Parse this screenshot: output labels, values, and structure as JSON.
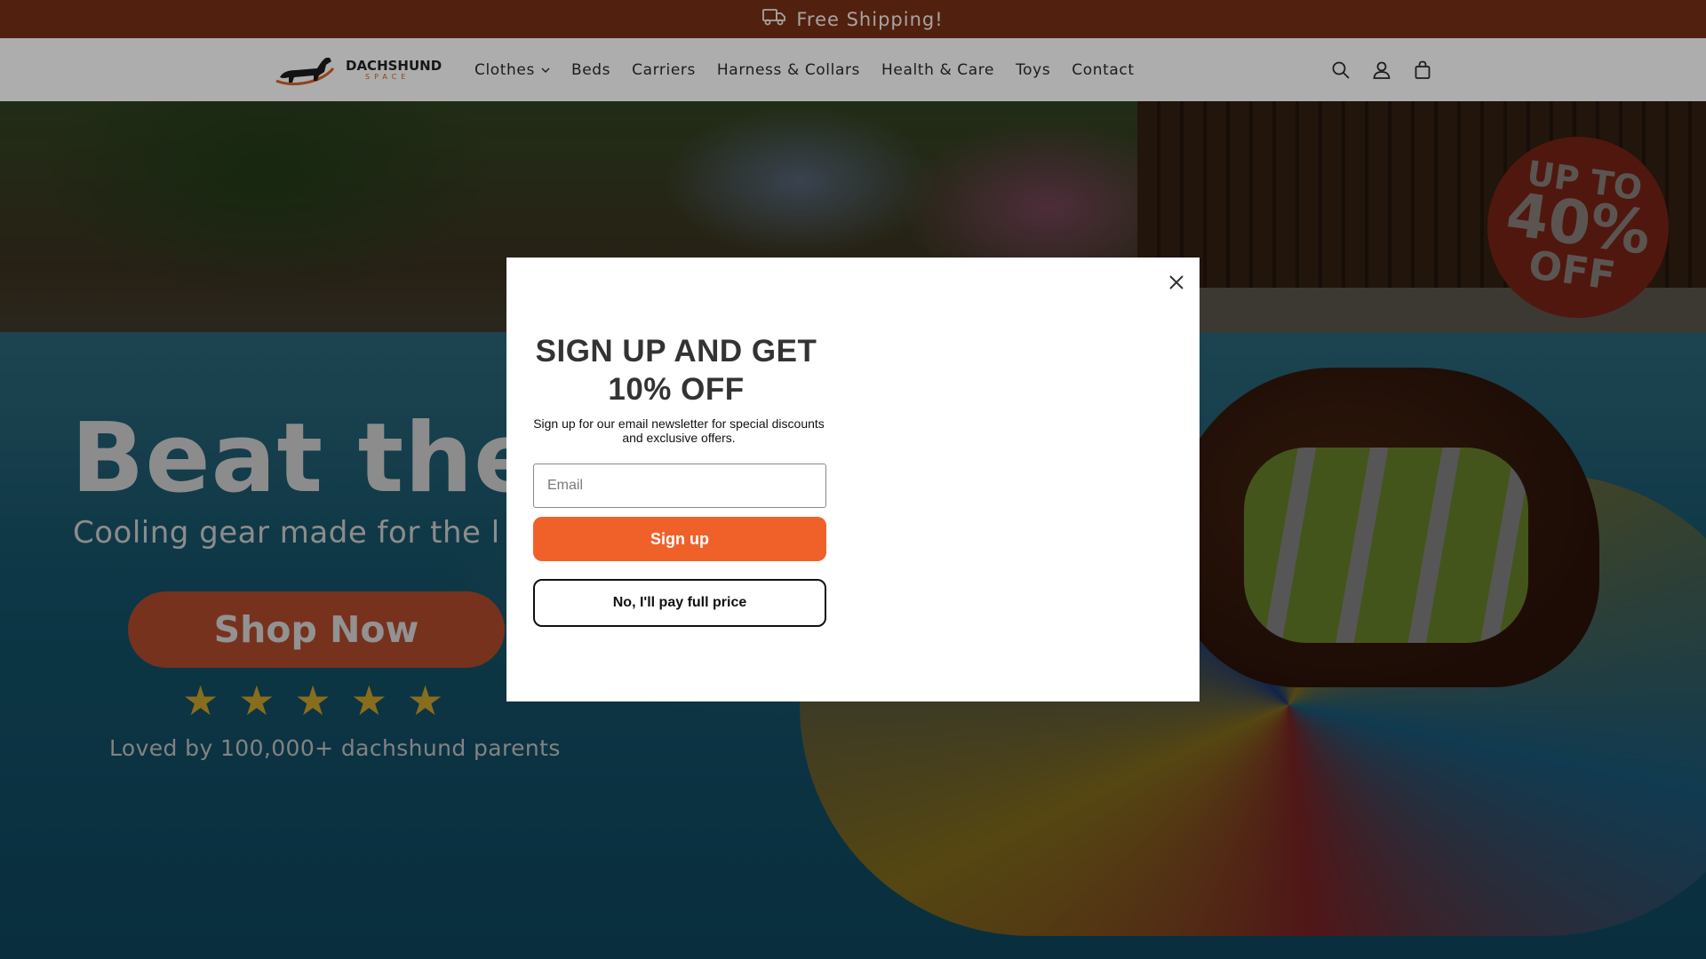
{
  "announcement": {
    "text": "Free Shipping!",
    "icon": "truck-icon"
  },
  "header": {
    "logo": {
      "name": "DACHSHUND",
      "sub": "SPACE"
    },
    "nav": [
      {
        "label": "Clothes",
        "has_dropdown": true
      },
      {
        "label": "Beds"
      },
      {
        "label": "Carriers"
      },
      {
        "label": "Harness & Collars"
      },
      {
        "label": "Health & Care"
      },
      {
        "label": "Toys"
      },
      {
        "label": "Contact"
      }
    ],
    "icons": [
      "search-icon",
      "account-icon",
      "cart-icon"
    ]
  },
  "hero": {
    "title": "Beat the",
    "subtitle": "Cooling gear made for the l",
    "cta": "Shop Now",
    "rating": {
      "stars": 5,
      "max": 5
    },
    "note": "Loved by 100,000+ dachshund parents",
    "badge": {
      "line1": "UP TO",
      "line2": "40%",
      "line3": "OFF"
    }
  },
  "modal": {
    "title": "SIGN UP AND GET 10% OFF",
    "description": "Sign up for our email newsletter for special discounts and exclusive offers.",
    "email_placeholder": "Email",
    "signup_label": "Sign up",
    "decline_label": "No, I'll pay full price"
  },
  "colors": {
    "announcement_bg": "#7a3016",
    "accent": "#f0612a",
    "badge": "#d9412a"
  }
}
